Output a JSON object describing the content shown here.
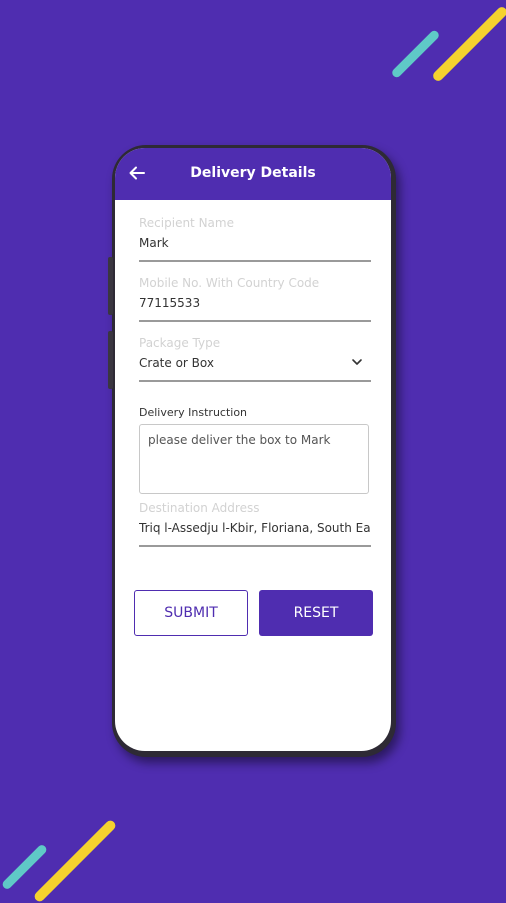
{
  "appbar": {
    "title": "Delivery Details"
  },
  "form": {
    "recipient": {
      "label": "Recipient Name",
      "value": "Mark"
    },
    "mobile": {
      "label": "Mobile No. With Country Code",
      "value": "77115533"
    },
    "package": {
      "label": "Package Type",
      "value": "Crate or Box"
    },
    "instruction": {
      "label": "Delivery Instruction",
      "value": "please deliver the box to Mark"
    },
    "destination": {
      "label": "Destination Address",
      "value": "Triq l-Assedju l-Kbir, Floriana, South Eas"
    }
  },
  "buttons": {
    "submit": "SUBMIT",
    "reset": "RESET"
  },
  "colors": {
    "primary": "#4f2db0",
    "accent_yellow": "#f5d22e",
    "accent_teal": "#5fc9c7"
  },
  "icons": {
    "back": "arrow-left-icon",
    "dropdown": "chevron-down-icon"
  }
}
